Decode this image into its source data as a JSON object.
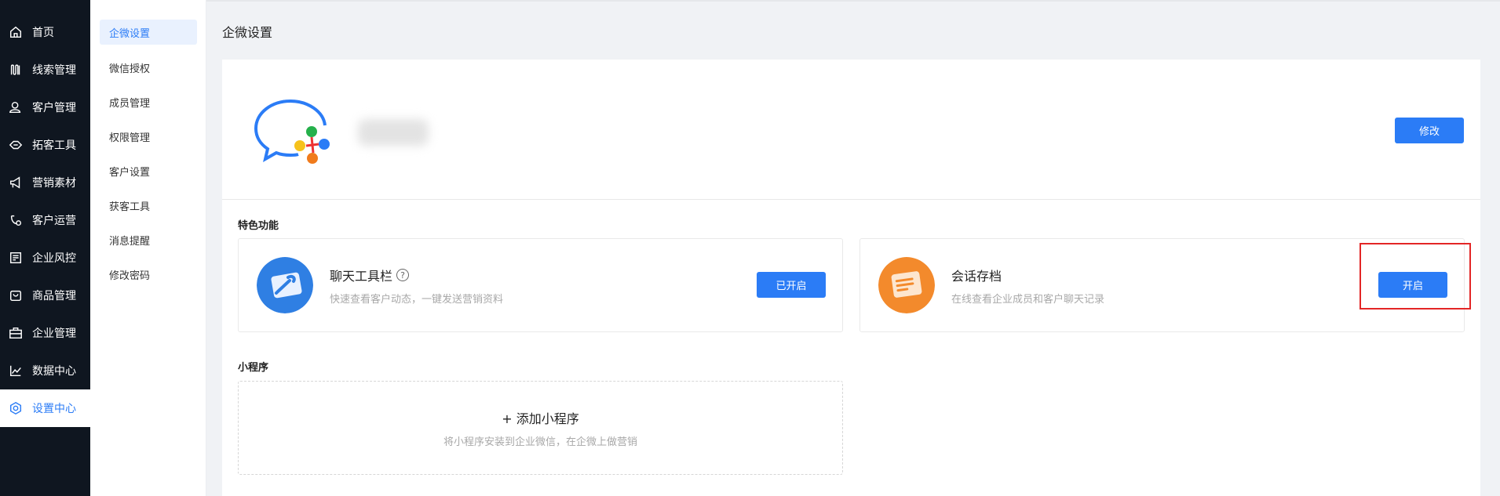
{
  "nav": {
    "items": [
      {
        "label": "首页",
        "icon": "home-icon"
      },
      {
        "label": "线索管理",
        "icon": "clue-icon"
      },
      {
        "label": "客户管理",
        "icon": "customer-icon"
      },
      {
        "label": "拓客工具",
        "icon": "tool-icon"
      },
      {
        "label": "营销素材",
        "icon": "megaphone-icon"
      },
      {
        "label": "客户运营",
        "icon": "operation-icon"
      },
      {
        "label": "企业风控",
        "icon": "risk-icon"
      },
      {
        "label": "商品管理",
        "icon": "goods-icon"
      },
      {
        "label": "企业管理",
        "icon": "briefcase-icon"
      },
      {
        "label": "数据中心",
        "icon": "chart-icon"
      },
      {
        "label": "设置中心",
        "icon": "settings-icon"
      }
    ],
    "active_index": 10
  },
  "submenu": {
    "items": [
      "企微设置",
      "微信授权",
      "成员管理",
      "权限管理",
      "客户设置",
      "获客工具",
      "消息提醒",
      "修改密码"
    ],
    "active_index": 0
  },
  "page": {
    "title": "企微设置"
  },
  "profile": {
    "edit_label": "修改"
  },
  "features": {
    "section_label": "特色功能",
    "cards": [
      {
        "title": "聊天工具栏",
        "desc": "快速查看客户动态，一键发送营销资料",
        "button": "已开启",
        "has_help": true
      },
      {
        "title": "会话存档",
        "desc": "在线查看企业成员和客户聊天记录",
        "button": "开启",
        "has_help": false
      }
    ]
  },
  "mini_program": {
    "section_label": "小程序",
    "add_label": "+ 添加小程序",
    "desc": "将小程序安装到企业微信，在企微上做营销"
  },
  "colors": {
    "accent": "#2b7cf6",
    "nav_bg": "#0f1620",
    "highlight": "#e32626"
  }
}
